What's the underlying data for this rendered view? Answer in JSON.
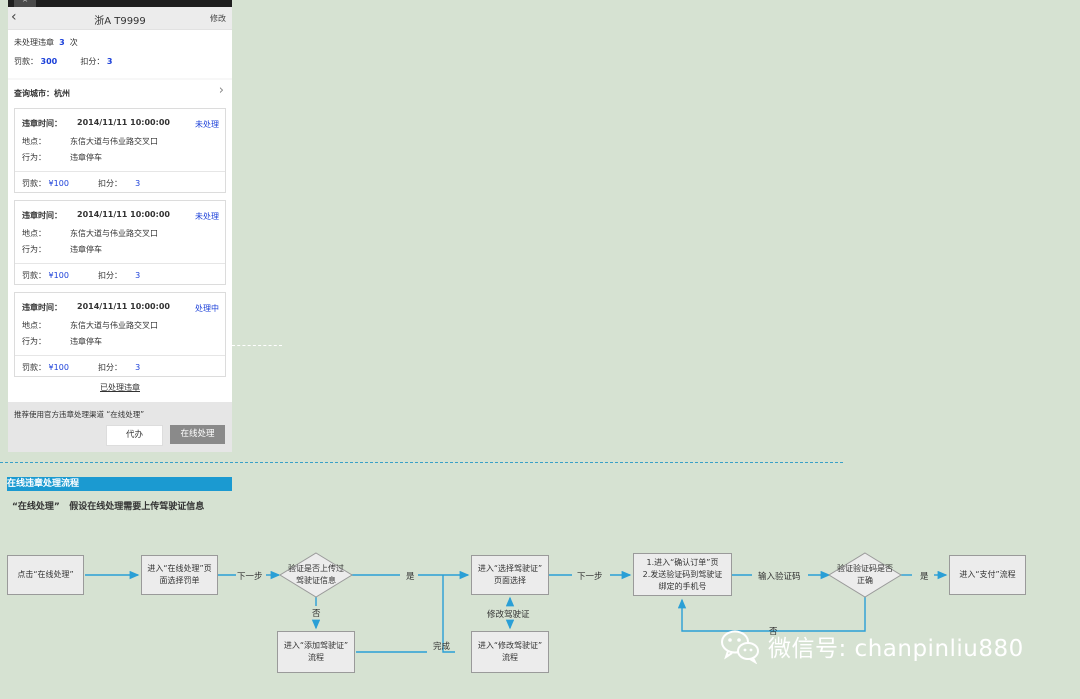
{
  "phone": {
    "statusbar_glyph": "^",
    "nav": {
      "back_glyph": "‹",
      "title": "浙A T9999",
      "edit": "修改"
    },
    "summary": {
      "unprocessed_label": "未处理违章",
      "unprocessed_count": "3",
      "unprocessed_unit": "次",
      "fine_label": "罚款：",
      "fine_value": "300",
      "points_label": "扣分：",
      "points_value": "3"
    },
    "city": {
      "label": "查询城市：杭州",
      "chevron": "›"
    },
    "cards": [
      {
        "time_label": "违章时间：",
        "time": "2014/11/11   10:00:00",
        "status": "未处理",
        "location_label": "地点：",
        "location": "东信大道与伟业路交叉口",
        "action_label": "行为：",
        "action": "违章停车",
        "fine_label": "罚款：",
        "fine": "¥100",
        "points_label": "扣分：",
        "points": "3"
      },
      {
        "time_label": "违章时间：",
        "time": "2014/11/11   10:00:00",
        "status": "未处理",
        "location_label": "地点：",
        "location": "东信大道与伟业路交叉口",
        "action_label": "行为：",
        "action": "违章停车",
        "fine_label": "罚款：",
        "fine": "¥100",
        "points_label": "扣分：",
        "points": "3"
      },
      {
        "time_label": "违章时间：",
        "time": "2014/11/11   10:00:00",
        "status": "处理中",
        "location_label": "地点：",
        "location": "东信大道与伟业路交叉口",
        "action_label": "行为：",
        "action": "违章停车",
        "fine_label": "罚款：",
        "fine": "¥100",
        "points_label": "扣分：",
        "points": "3"
      }
    ],
    "processed_link": "已处理违章",
    "footer": {
      "tip": "推荐使用官方违章处理渠道 “在线处理”",
      "proxy_button": "代办",
      "online_button": "在线处理"
    }
  },
  "flow": {
    "section_title": "在线违章处理流程",
    "assumption_quote": "“在线处理”",
    "assumption_text": "假设在线处理需要上传驾驶证信息",
    "nodes": {
      "click_online": "点击“在线处理”",
      "enter_online_1": "进入“在线处理”页",
      "enter_online_2": "面选择罚单",
      "uploaded_q_1": "验证是否上传过",
      "uploaded_q_2": "驾驶证信息",
      "select_license_1": "进入“选择驾驶证”",
      "select_license_2": "页面选择",
      "add_license_1": "进入“添加驾驶证”",
      "add_license_2": "流程",
      "modify_license_1": "进入“修改驾驶证”",
      "modify_license_2": "流程",
      "confirm_1": "1.进入“确认订单”页",
      "confirm_2": "2.发送验证码到驾驶证",
      "confirm_3": "绑定的手机号",
      "code_q_1": "验证验证码是否",
      "code_q_2": "正确",
      "pay": "进入“支付”流程"
    },
    "edges": {
      "next1": "下一步",
      "yes1": "是",
      "no1": "否",
      "done": "完成",
      "modify_license": "修改驾驶证",
      "next2": "下一步",
      "enter_code": "输入验证码",
      "yes2": "是",
      "no2": "否"
    }
  },
  "watermark": {
    "text": "微信号: chanpinliu880"
  },
  "colors": {
    "background": "#d6e2d2",
    "flow_line": "#2a9fd6",
    "accent_blue": "#1a3fd9",
    "title_bar": "#1b9ad1"
  }
}
